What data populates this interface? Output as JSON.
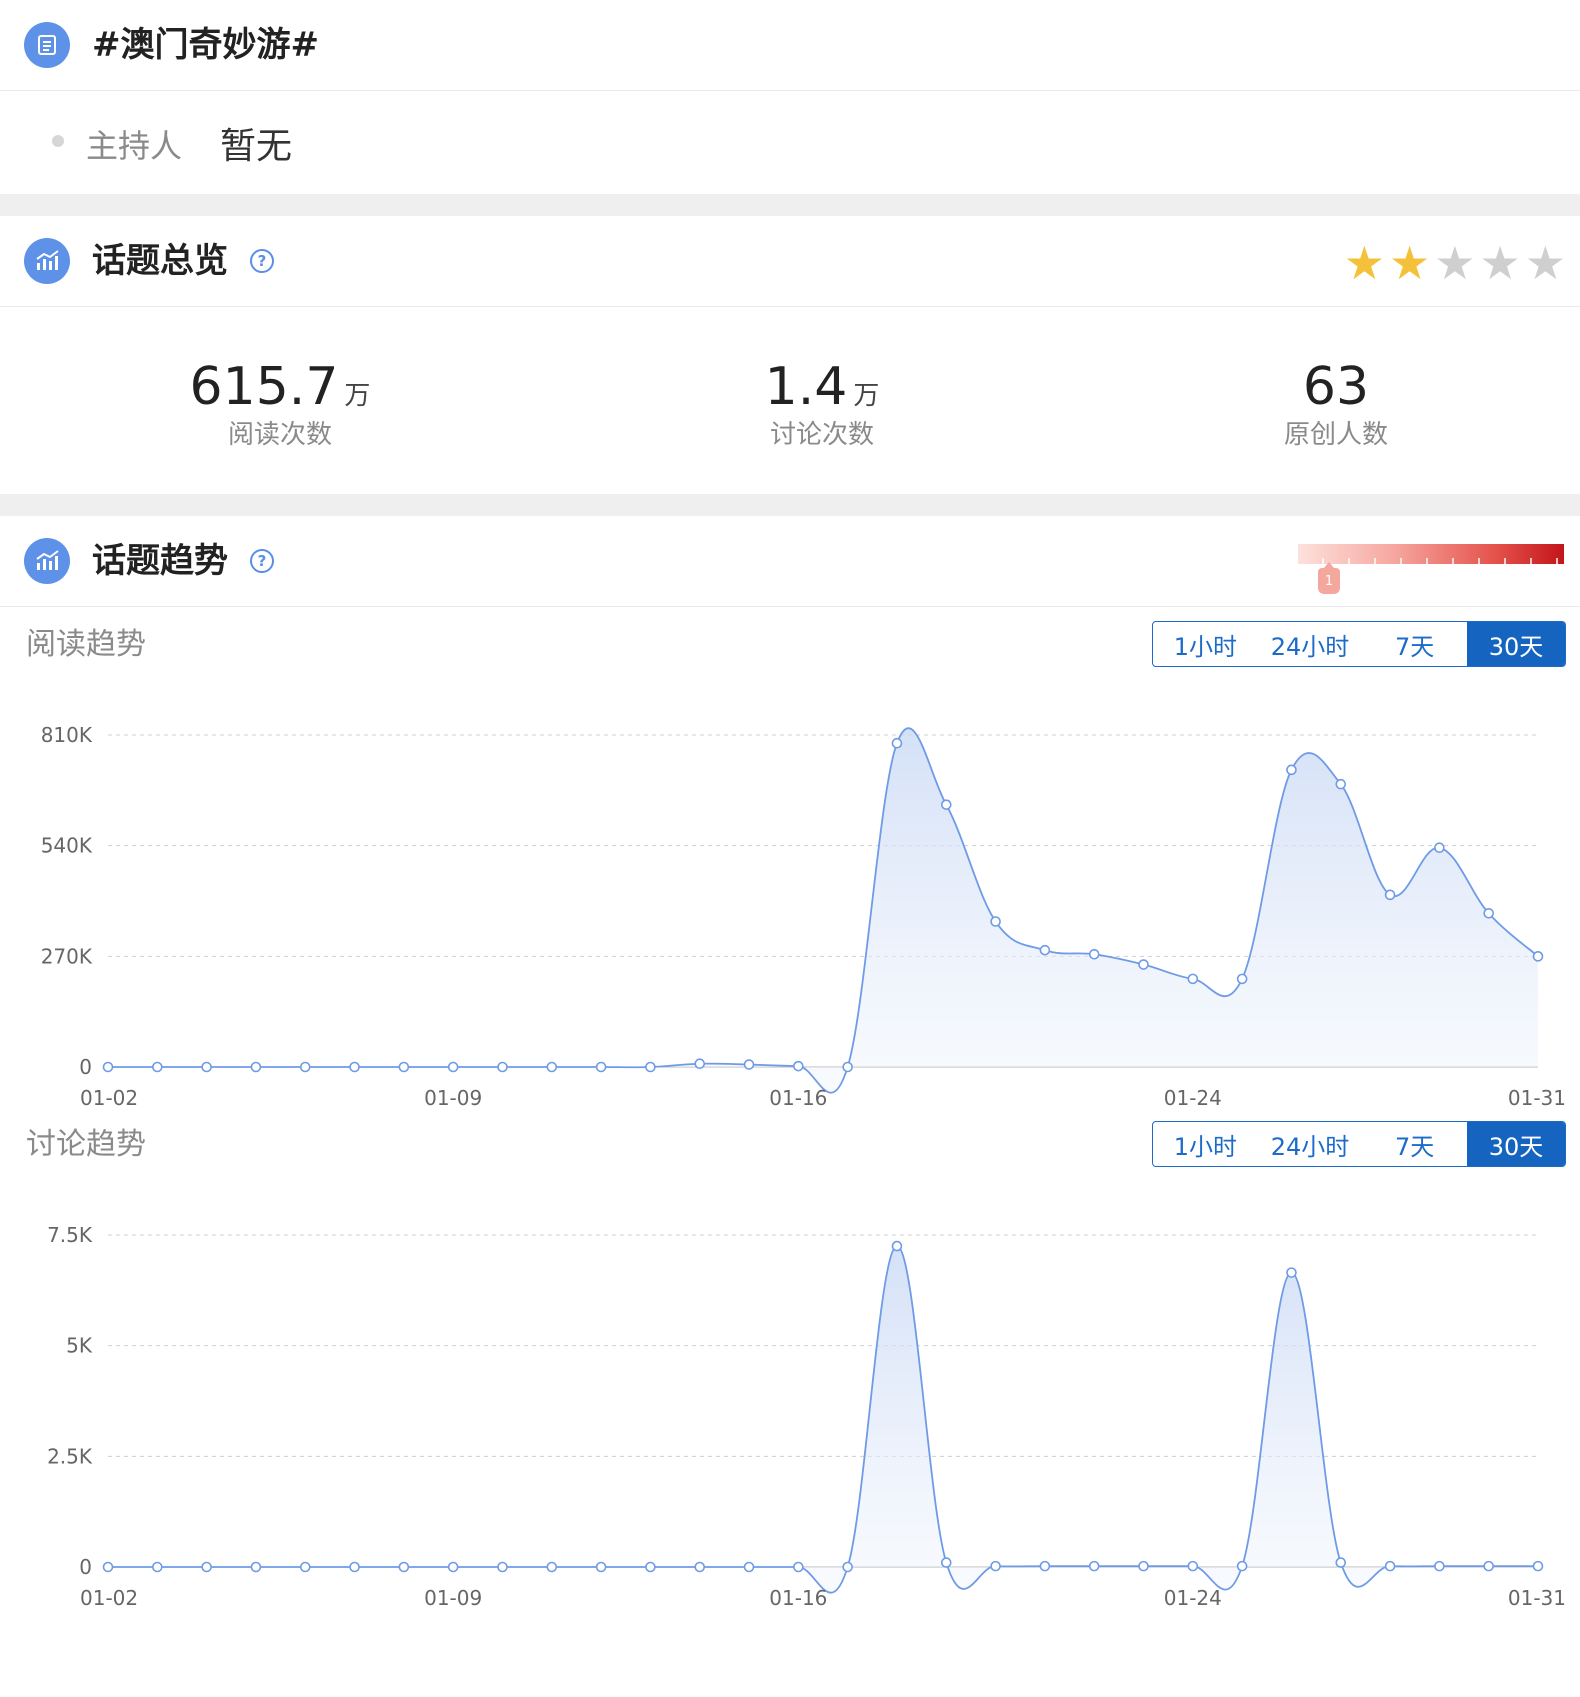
{
  "topic": {
    "title": "#澳门奇妙游#"
  },
  "host": {
    "label": "主持人",
    "value": "暂无"
  },
  "overview": {
    "title": "话题总览",
    "help_icon": "question-circle-icon",
    "rating": {
      "value": 2,
      "max": 5
    },
    "stats": [
      {
        "value": "615.7",
        "unit": "万",
        "label": "阅读次数"
      },
      {
        "value": "1.4",
        "unit": "万",
        "label": "讨论次数"
      },
      {
        "value": "63",
        "unit": "",
        "label": "原创人数"
      }
    ]
  },
  "trend": {
    "title": "话题趋势",
    "heat_marker": "1",
    "colors": {
      "accent": "#1565c0",
      "line": "#6f9be6",
      "heat_low": "#fde1dc",
      "heat_high": "#c3151a"
    }
  },
  "time_ranges": [
    "1小时",
    "24小时",
    "7天",
    "30天"
  ],
  "selected_range": "30天",
  "chart_data": [
    {
      "type": "area",
      "title": "阅读趋势",
      "x": [
        "01-02",
        "01-03",
        "01-04",
        "01-05",
        "01-06",
        "01-07",
        "01-08",
        "01-09",
        "01-10",
        "01-11",
        "01-12",
        "01-13",
        "01-14",
        "01-15",
        "01-16",
        "01-17",
        "01-18",
        "01-19",
        "01-20",
        "01-21",
        "01-22",
        "01-23",
        "01-24",
        "01-25",
        "01-26",
        "01-27",
        "01-28",
        "01-29",
        "01-30",
        "01-31"
      ],
      "x_ticks": [
        "01-02",
        "01-09",
        "01-16",
        "01-24",
        "01-31"
      ],
      "y_ticks": [
        "0",
        "270K",
        "540K",
        "810K"
      ],
      "ylim": [
        0,
        810000
      ],
      "values": [
        0,
        0,
        0,
        0,
        0,
        0,
        0,
        0,
        0,
        0,
        0,
        0,
        8000,
        6000,
        2000,
        0,
        790000,
        640000,
        355000,
        285000,
        275000,
        250000,
        215000,
        215000,
        725000,
        690000,
        420000,
        535000,
        375000,
        270000
      ],
      "grid": true
    },
    {
      "type": "area",
      "title": "讨论趋势",
      "x": [
        "01-02",
        "01-03",
        "01-04",
        "01-05",
        "01-06",
        "01-07",
        "01-08",
        "01-09",
        "01-10",
        "01-11",
        "01-12",
        "01-13",
        "01-14",
        "01-15",
        "01-16",
        "01-17",
        "01-18",
        "01-19",
        "01-20",
        "01-21",
        "01-22",
        "01-23",
        "01-24",
        "01-25",
        "01-26",
        "01-27",
        "01-28",
        "01-29",
        "01-30",
        "01-31"
      ],
      "x_ticks": [
        "01-02",
        "01-09",
        "01-16",
        "01-24",
        "01-31"
      ],
      "y_ticks": [
        "0",
        "2.5K",
        "5K",
        "7.5K"
      ],
      "ylim": [
        0,
        7500
      ],
      "values": [
        0,
        0,
        0,
        0,
        0,
        0,
        0,
        0,
        0,
        0,
        0,
        0,
        0,
        0,
        0,
        0,
        7250,
        100,
        20,
        20,
        20,
        20,
        20,
        20,
        6650,
        100,
        20,
        20,
        20,
        20
      ],
      "grid": true
    }
  ]
}
